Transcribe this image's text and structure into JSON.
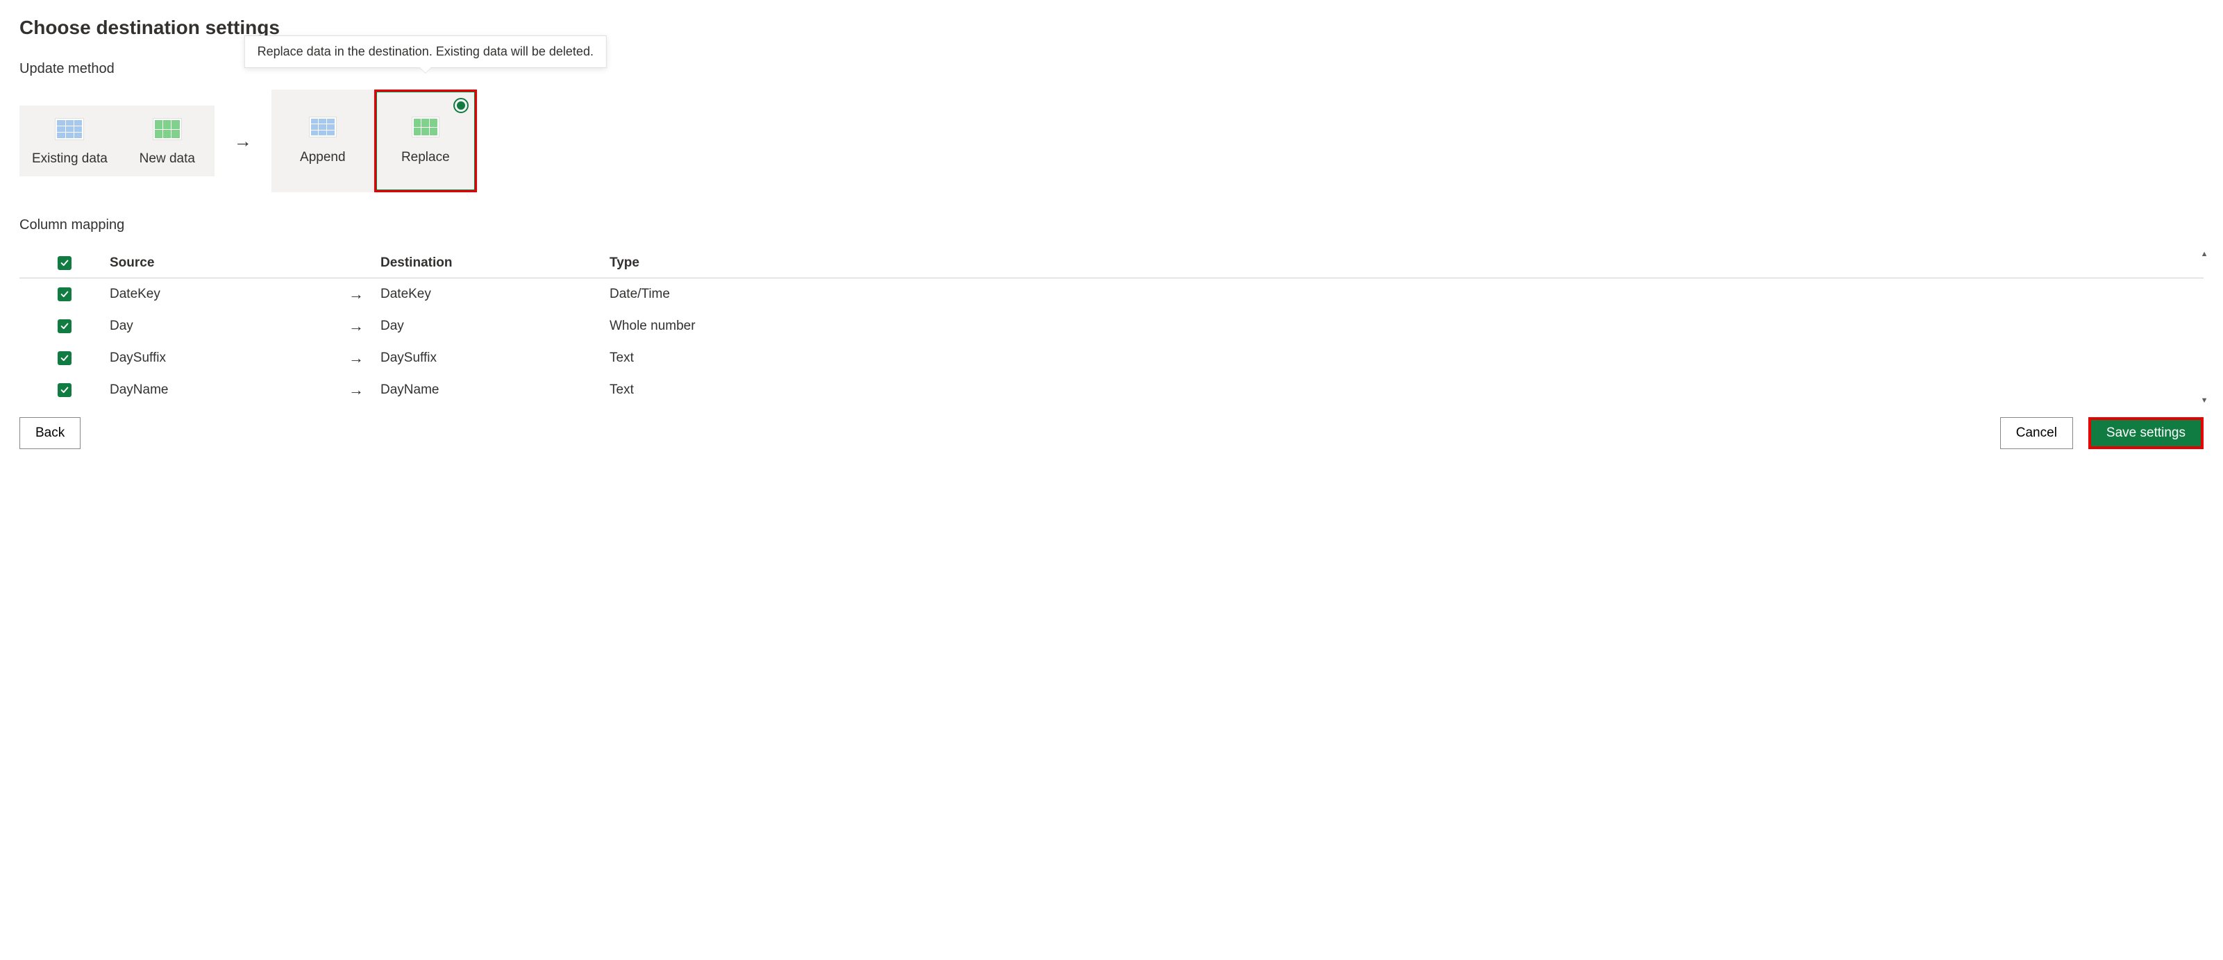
{
  "pageTitle": "Choose destination settings",
  "updateMethod": {
    "label": "Update method",
    "existingLabel": "Existing data",
    "newLabel": "New data",
    "appendLabel": "Append",
    "replaceLabel": "Replace",
    "tooltip": "Replace data in the destination. Existing data will be deleted."
  },
  "columnMapping": {
    "label": "Column mapping",
    "headers": {
      "source": "Source",
      "destination": "Destination",
      "type": "Type"
    },
    "rows": [
      {
        "source": "DateKey",
        "destination": "DateKey",
        "type": "Date/Time"
      },
      {
        "source": "Day",
        "destination": "Day",
        "type": "Whole number"
      },
      {
        "source": "DaySuffix",
        "destination": "DaySuffix",
        "type": "Text"
      },
      {
        "source": "DayName",
        "destination": "DayName",
        "type": "Text"
      }
    ]
  },
  "footer": {
    "back": "Back",
    "cancel": "Cancel",
    "save": "Save settings"
  }
}
